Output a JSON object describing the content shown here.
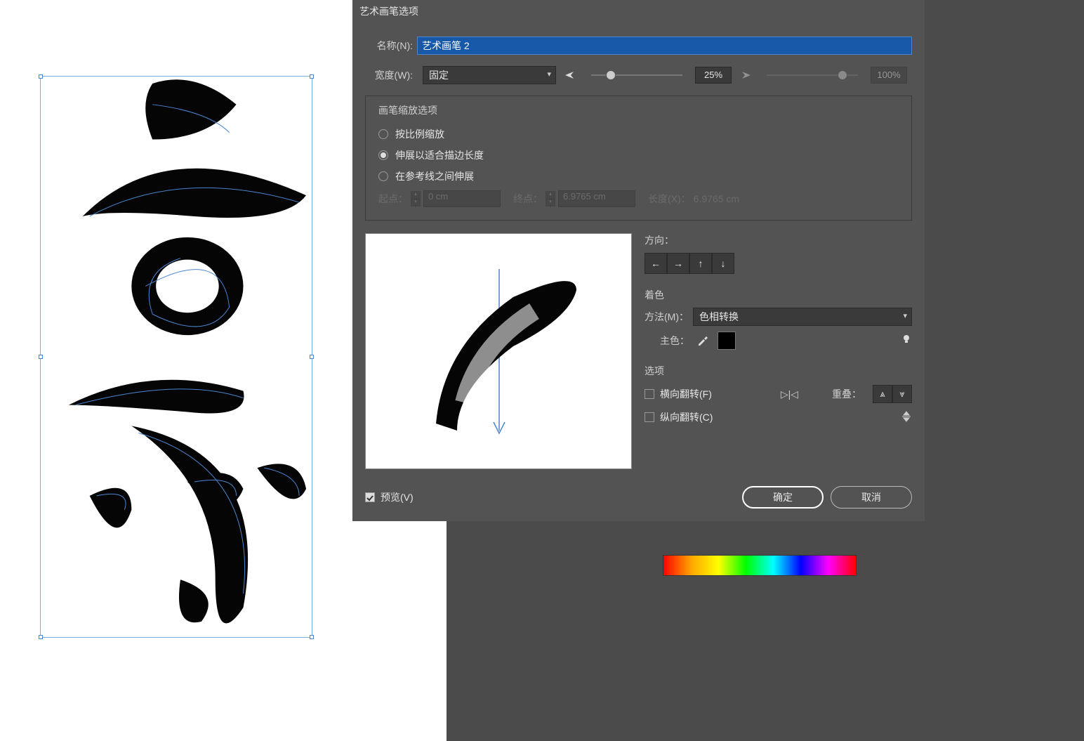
{
  "dialog": {
    "title": "艺术画笔选项",
    "name_label": "名称(N):",
    "name_value": "艺术画笔 2",
    "width_label": "宽度(W):",
    "width_mode": "固定",
    "width_pct1": "25%",
    "width_pct2": "100%"
  },
  "scale_group": {
    "title": "画笔缩放选项",
    "opt_proportional": "按比例缩放",
    "opt_stretch": "伸展以适合描边长度",
    "opt_guides": "在参考线之间伸展",
    "start_label": "起点：",
    "start_value": "0 cm",
    "end_label": "终点：",
    "end_value": "6.9765 cm",
    "length_label": "长度(X)：",
    "length_value": "6.9765 cm"
  },
  "direction": {
    "title": "方向："
  },
  "tint": {
    "title": "着色",
    "method_label": "方法(M)：",
    "method_value": "色相转换",
    "main_color_label": "主色："
  },
  "options": {
    "title": "选项",
    "flip_h": "横向翻转(F)",
    "flip_v": "纵向翻转(C)",
    "overlap_label": "重叠："
  },
  "footer": {
    "preview": "预览(V)",
    "ok": "确定",
    "cancel": "取消"
  }
}
